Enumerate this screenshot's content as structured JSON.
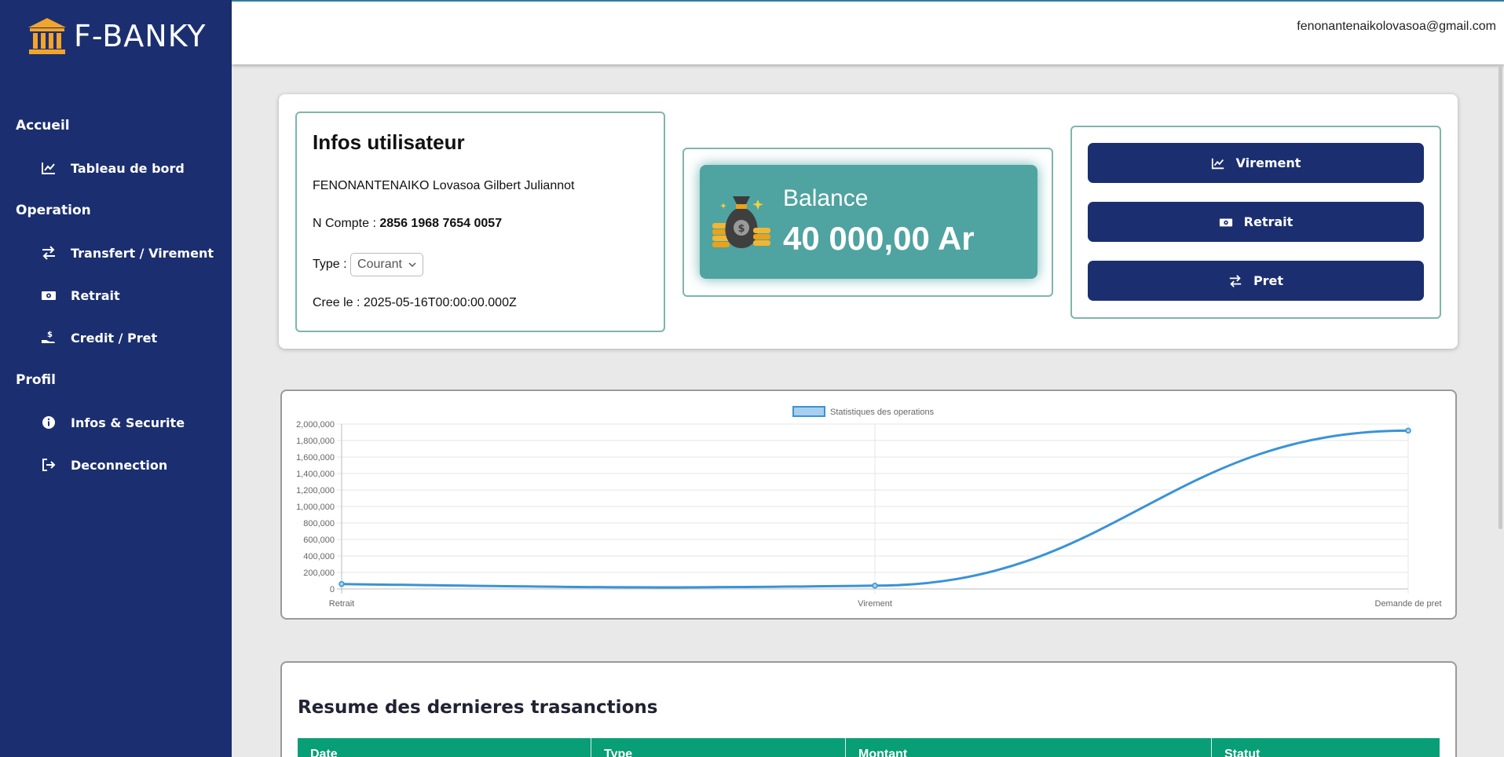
{
  "brand": {
    "name": "F-BANKY"
  },
  "topbar": {
    "email": "fenonantenaikolovasoa@gmail.com"
  },
  "sidebar": {
    "sections": [
      {
        "label": "Accueil",
        "items": [
          {
            "label": "Tableau de bord",
            "icon": "chart-line-icon"
          }
        ]
      },
      {
        "label": "Operation",
        "items": [
          {
            "label": "Transfert / Virement",
            "icon": "exchange-icon"
          },
          {
            "label": "Retrait",
            "icon": "money-bill-icon"
          },
          {
            "label": "Credit / Pret",
            "icon": "hand-holding-dollar-icon"
          }
        ]
      },
      {
        "label": "Profil",
        "items": [
          {
            "label": "Infos & Securite",
            "icon": "info-circle-icon"
          },
          {
            "label": "Deconnection",
            "icon": "sign-out-icon"
          }
        ]
      }
    ]
  },
  "user_info": {
    "title": "Infos utilisateur",
    "name": "FENONANTENAIKO Lovasoa Gilbert Juliannot",
    "account_label": "N Compte :",
    "account_number": "2856 1968 7654 0057",
    "type_label": "Type :",
    "type_value": "Courant",
    "created_label": "Cree le :",
    "created_value": "2025-05-16T00:00:00.000Z"
  },
  "balance": {
    "label": "Balance",
    "value": "40 000,00 Ar",
    "icon": "money-bag-icon"
  },
  "actions": [
    {
      "label": "Virement",
      "icon": "chart-line-icon"
    },
    {
      "label": "Retrait",
      "icon": "money-bill-icon"
    },
    {
      "label": "Pret",
      "icon": "exchange-icon"
    }
  ],
  "chart_data": {
    "type": "line",
    "categories": [
      "Retrait",
      "Virement",
      "Demande de pret"
    ],
    "series": [
      {
        "name": "Statistiques des operations",
        "values": [
          60000,
          40000,
          1920000
        ]
      }
    ],
    "ylim": [
      0,
      2000000
    ],
    "yticks": [
      "0",
      "200,000",
      "400,000",
      "600,000",
      "800,000",
      "1,000,000",
      "1,200,000",
      "1,400,000",
      "1,600,000",
      "1,800,000",
      "2,000,000"
    ],
    "grid": true,
    "legend": "top",
    "color": "#3a93d6"
  },
  "transactions": {
    "title": "Resume des dernieres trasanctions",
    "columns": [
      "Date",
      "Type",
      "Montant",
      "Statut"
    ]
  },
  "colors": {
    "sidebar": "#1b2f70",
    "balance_card": "#4fa3a0",
    "table_header": "#089e76",
    "brand_icon": "#f3a42b"
  }
}
